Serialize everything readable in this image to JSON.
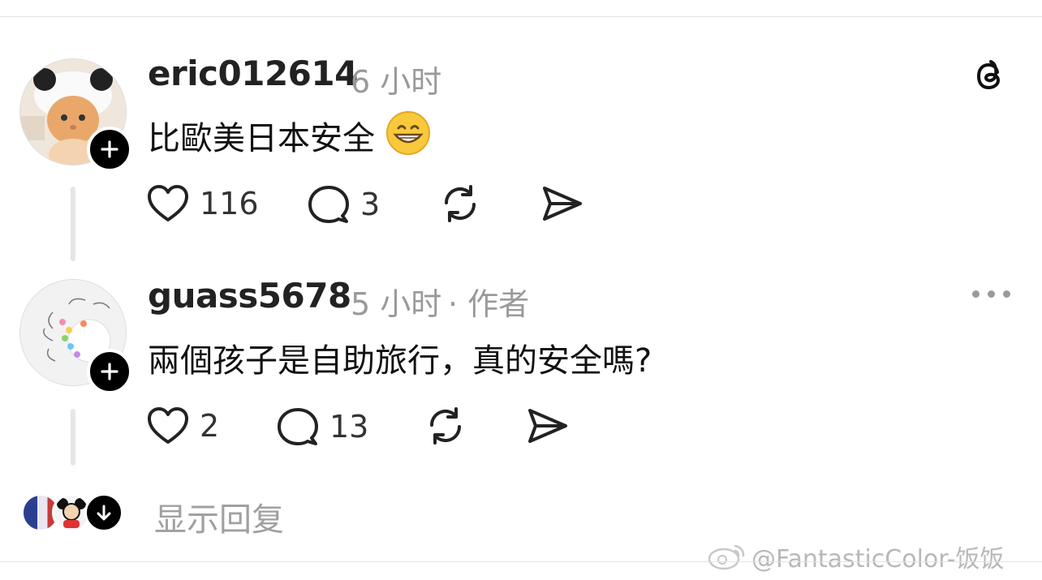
{
  "posts": [
    {
      "username": "eric012614",
      "time": "6 小时",
      "text": "比歐美日本安全",
      "emoji": "grinning-face",
      "likes": "116",
      "comments": "3"
    },
    {
      "username": "guass5678",
      "time": "5 小时",
      "author_tag": "· 作者",
      "text": "兩個孩子是自助旅行，真的安全嗎?",
      "likes": "2",
      "comments": "13"
    }
  ],
  "show_replies_label": "显示回复",
  "watermark": "@FantasticColor-饭饭",
  "colors": {
    "text": "#111111",
    "muted": "#9a9a9a",
    "divider": "#e3e3e3",
    "badge": "#000000"
  }
}
